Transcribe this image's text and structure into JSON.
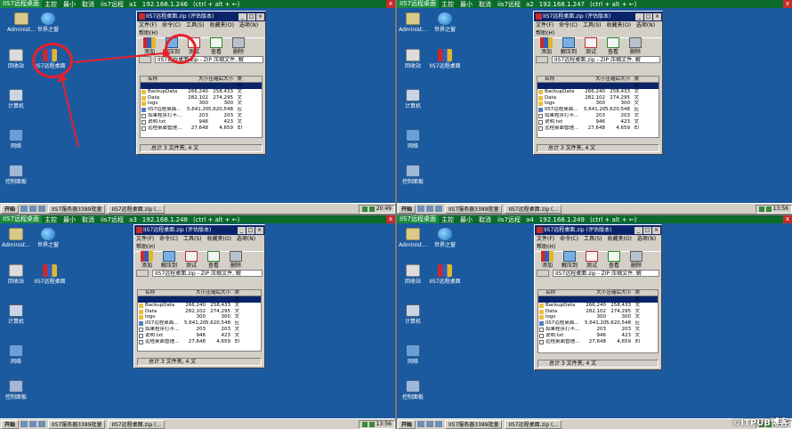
{
  "panes": [
    {
      "tag": "IIS7远程桌面",
      "main": "主控",
      "minimize": "最小",
      "cancel": "取消",
      "label": "iis7远程",
      "id": "a1",
      "host": "192.168.1.246",
      "hint": "(ctrl + alt + ←)",
      "close": "x",
      "clock": "20:49"
    },
    {
      "tag": "IIS7远程桌面",
      "main": "主控",
      "minimize": "最小",
      "cancel": "取消",
      "label": "iis7远程",
      "id": "a2",
      "host": "192.168.1.247",
      "hint": "(ctrl + alt + ←)",
      "close": "x",
      "clock": "13:56"
    },
    {
      "tag": "IIS7远程桌面",
      "main": "主控",
      "minimize": "最小",
      "cancel": "取消",
      "label": "iis7远程",
      "id": "a3",
      "host": "192.168.1.248",
      "hint": "(ctrl + alt + ←)",
      "close": "x",
      "clock": "13:56"
    },
    {
      "tag": "IIS7远程桌面",
      "main": "主控",
      "minimize": "最小",
      "cancel": "取消",
      "label": "iis7远程",
      "id": "a4",
      "host": "192.168.1.249",
      "hint": "(ctrl + alt + ←)",
      "close": "x",
      "clock": "13:56"
    }
  ],
  "desktop": {
    "admin": "Administ...",
    "world": "世界之窗",
    "bin": "回收站",
    "rar": "IIS7远程桌面",
    "computer": "计算机",
    "network": "网络",
    "control": "控制面板"
  },
  "taskbar": {
    "start": "开始",
    "task1": "IIS7服务器3389批量",
    "task2": "IIS7远程桌面.zip (..."
  },
  "winrar": {
    "title": "IIS7远程桌面.zip (评估版本)",
    "menu": [
      "文件(F)",
      "命令(C)",
      "工具(S)",
      "收藏夹(O)",
      "选项(N)"
    ],
    "help": "帮助(H)",
    "toolbar": [
      "添加",
      "解压到",
      "测试",
      "查看",
      "删除"
    ],
    "path": "IIS7远程桌面.zip - ZIP 压缩文件, 解",
    "columns": [
      "名称",
      "大小",
      "压缩后大小",
      "类"
    ],
    "rows": [
      {
        "name": "..",
        "size": "",
        "packed": "",
        "type": "文"
      },
      {
        "name": "BackupData",
        "size": "266,240",
        "packed": "258,433",
        "type": "文"
      },
      {
        "name": "Data",
        "size": "282,102",
        "packed": "274,295",
        "type": "文"
      },
      {
        "name": "logs",
        "size": "300",
        "packed": "300",
        "type": "文"
      },
      {
        "name": "IIS7远程桌面...",
        "size": "5,641,208",
        "packed": "5,620,548",
        "type": "应"
      },
      {
        "name": "如果程序打不...",
        "size": "203",
        "packed": "203",
        "type": "文"
      },
      {
        "name": "说明.txt",
        "size": "946",
        "packed": "423",
        "type": "文"
      },
      {
        "name": "远程桌面管理...",
        "size": "27,648",
        "packed": "4,659",
        "type": "El"
      }
    ],
    "status": "总计 3 文件夹, 4 文"
  },
  "watermark": "©ITPUB博客",
  "colors": {
    "desktop": "#1c5aa0",
    "pane_bar": "#0a6b2a",
    "highlight": "#e8202a"
  }
}
